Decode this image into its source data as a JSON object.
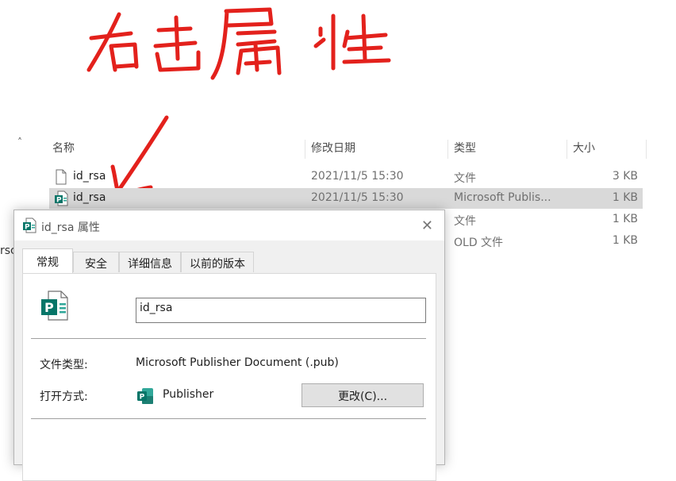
{
  "annotation": {
    "text": "右击属性"
  },
  "explorer": {
    "columns": {
      "name": "名称",
      "date": "修改日期",
      "type": "类型",
      "size": "大小"
    },
    "rows": [
      {
        "name": "id_rsa",
        "date": "2021/11/5 15:30",
        "type": "文件",
        "size": "3 KB",
        "icon": "blank-file-icon"
      },
      {
        "name": "id_rsa",
        "date": "2021/11/5 15:30",
        "type": "Microsoft Publis...",
        "size": "1 KB",
        "icon": "publisher-file-icon"
      },
      {
        "name": "",
        "date": "",
        "type": "文件",
        "size": "1 KB",
        "icon": ""
      },
      {
        "name": "",
        "date": "",
        "type": "OLD 文件",
        "size": "1 KB",
        "icon": ""
      }
    ],
    "left_edge_text": "rsc"
  },
  "dialog": {
    "title": "id_rsa 属性",
    "tabs": [
      "常规",
      "安全",
      "详细信息",
      "以前的版本"
    ],
    "file_name": "id_rsa",
    "file_type_label": "文件类型:",
    "file_type_value": "Microsoft Publisher Document (.pub)",
    "open_with_label": "打开方式:",
    "open_with_app": "Publisher",
    "change_button": "更改(C)..."
  }
}
